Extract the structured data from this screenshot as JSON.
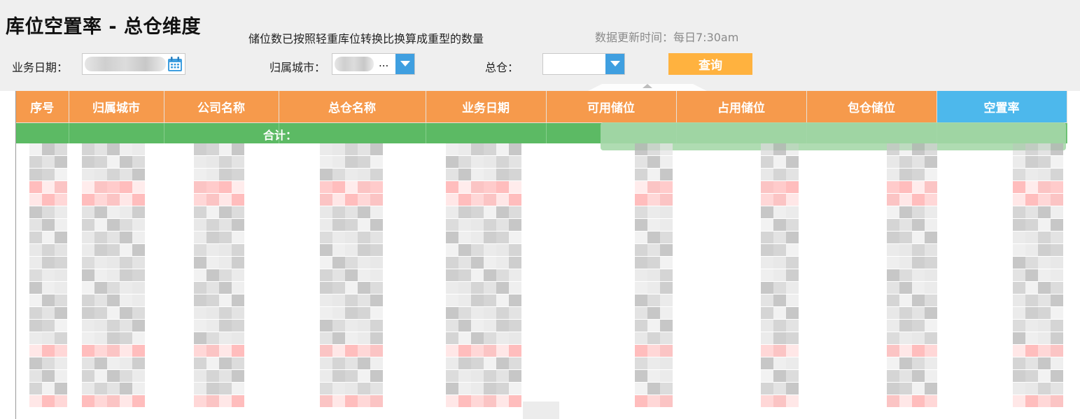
{
  "header": {
    "title": "库位空置率 - 总仓维度",
    "note": "储位数已按照轻重库位转换比换算成重型的数量",
    "update_time": "数据更新时间：每日7:30am"
  },
  "filters": {
    "biz_date_label": "业务日期：",
    "city_label": "归属城市：",
    "city_value": "...",
    "warehouse_label": "总仓：",
    "query_button": "查询"
  },
  "table": {
    "columns": [
      "序号",
      "归属城市",
      "公司名称",
      "总仓名称",
      "业务日期",
      "可用储位",
      "占用储位",
      "包仓储位",
      "空置率"
    ],
    "summary_label": "合计："
  },
  "icons": {
    "calendar": "calendar-icon",
    "dropdown": "chevron-down-icon"
  },
  "colors": {
    "header_orange": "#f69a4c",
    "header_blue": "#4db8ec",
    "summary_green": "#5cba64",
    "query_button": "#ffb23f",
    "dropdown_button": "#3f9fe0",
    "highlight_row": "#ffb9b9"
  }
}
